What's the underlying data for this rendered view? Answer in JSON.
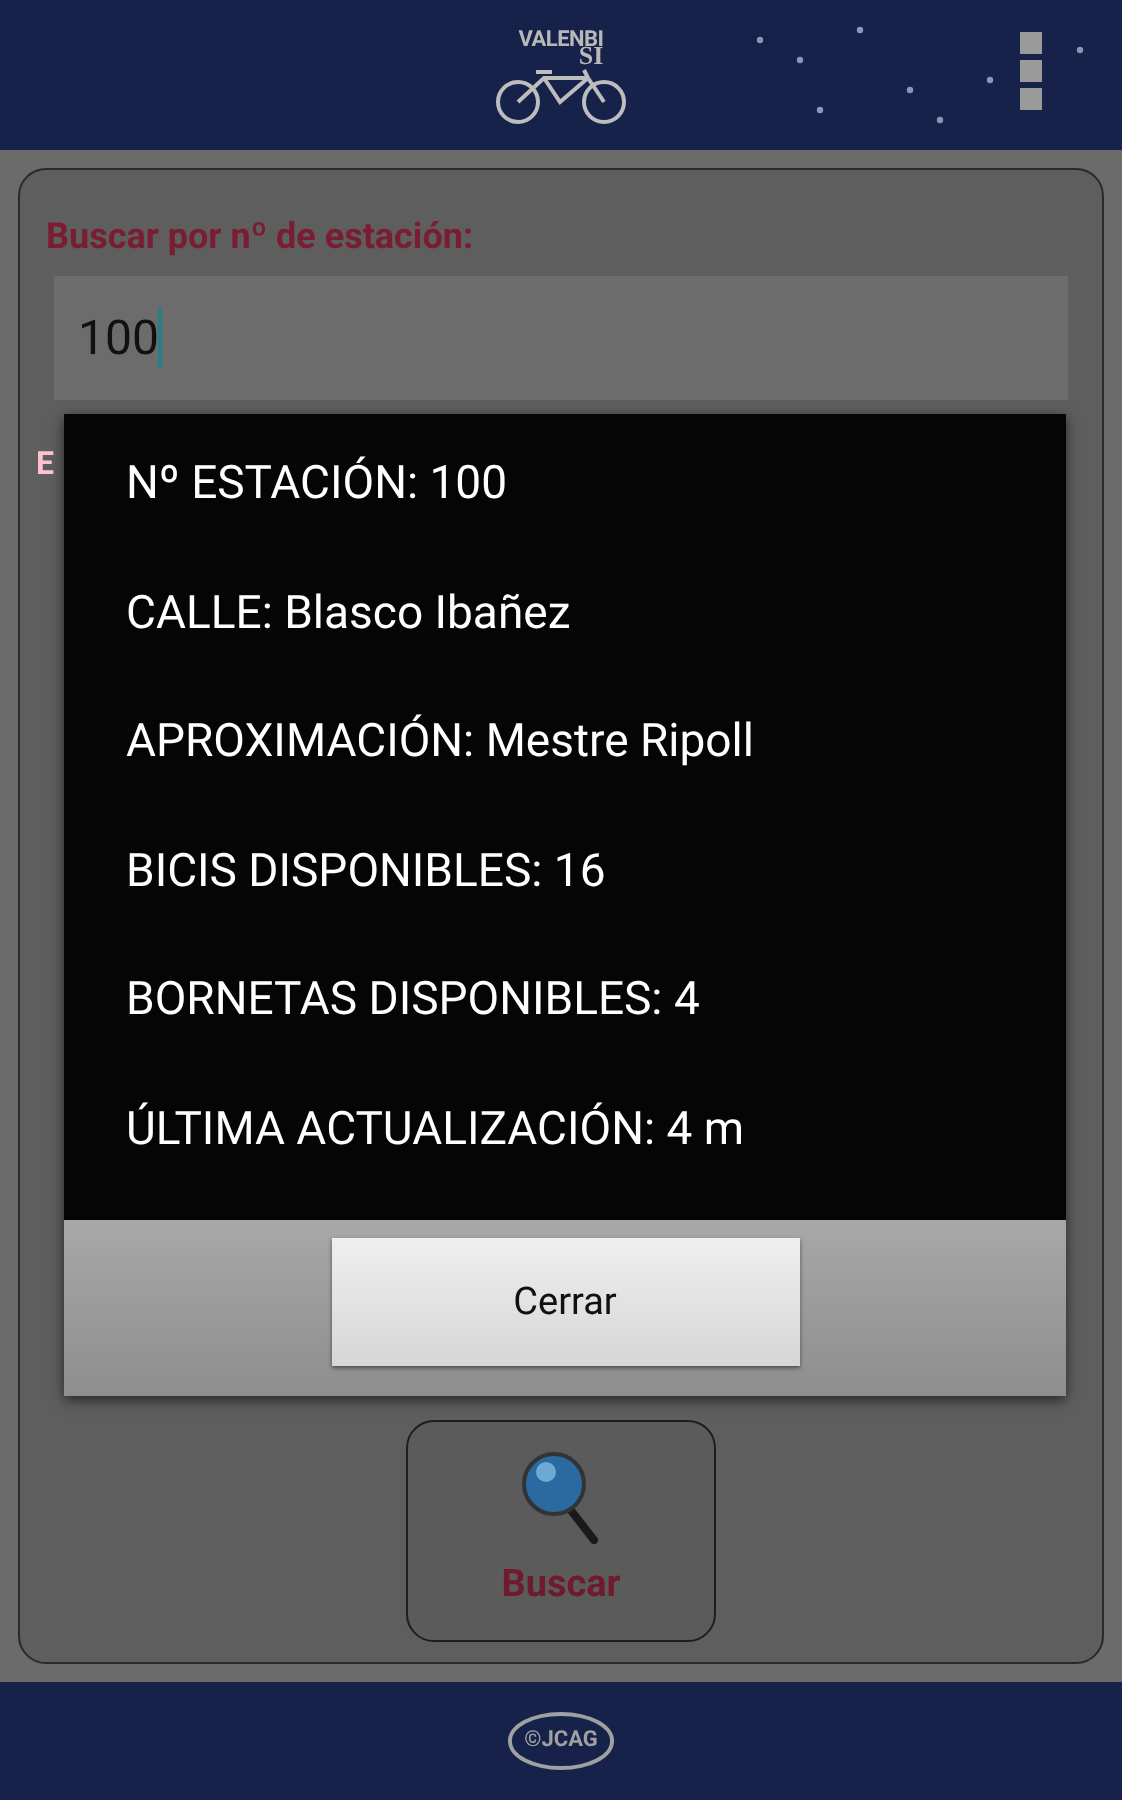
{
  "header": {
    "logo_top": "VALENBI",
    "logo_bottom": "SI"
  },
  "form": {
    "station_label": "Buscar por nº de estación:",
    "station_value": "100",
    "second_label": "E",
    "search_button": "Buscar"
  },
  "dialog": {
    "lines": [
      "Nº ESTACIÓN: 100",
      "CALLE: Blasco Ibañez",
      "APROXIMACIÓN: Mestre Ripoll",
      "BICIS DISPONIBLES: 16",
      "BORNETAS DISPONIBLES: 4",
      "ÚLTIMA ACTUALIZACIÓN: 4 m"
    ],
    "close_button": "Cerrar"
  },
  "footer": {
    "logo": "©JCAG"
  }
}
